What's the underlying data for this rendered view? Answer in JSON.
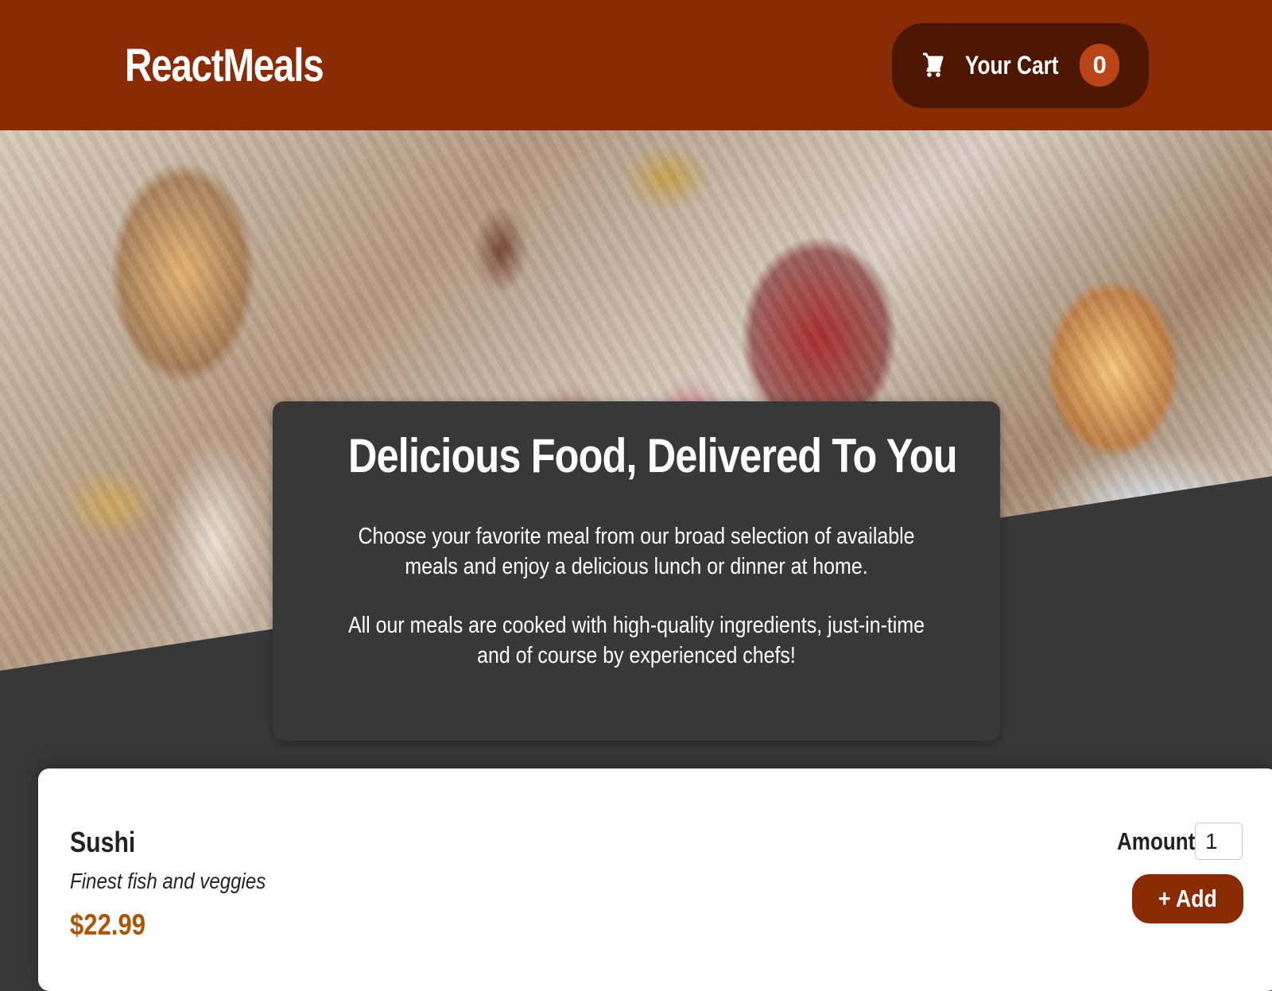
{
  "header": {
    "brand": "ReactMeals",
    "cart": {
      "label": "Your Cart",
      "count": "0",
      "icon": "cart-icon"
    }
  },
  "hero": {
    "image": "buffet table with catered food trays"
  },
  "summary": {
    "title": "Delicious Food, Delivered To You",
    "paragraphs": [
      "Choose your favorite meal from our broad selection of available meals and enjoy a delicious lunch or dinner at home.",
      "All our meals are cooked with high-quality ingredients, just-in-time and of course by experienced chefs!"
    ]
  },
  "meals": [
    {
      "name": "Sushi",
      "description": "Finest fish and veggies",
      "price": "$22.99",
      "amount_label": "Amount",
      "amount_value": "1",
      "add_label": "+ Add"
    }
  ],
  "colors": {
    "header": "#8a2b06",
    "cart_button": "#4d1601",
    "badge": "#b94517",
    "background": "#383838",
    "price": "#ad5502"
  }
}
